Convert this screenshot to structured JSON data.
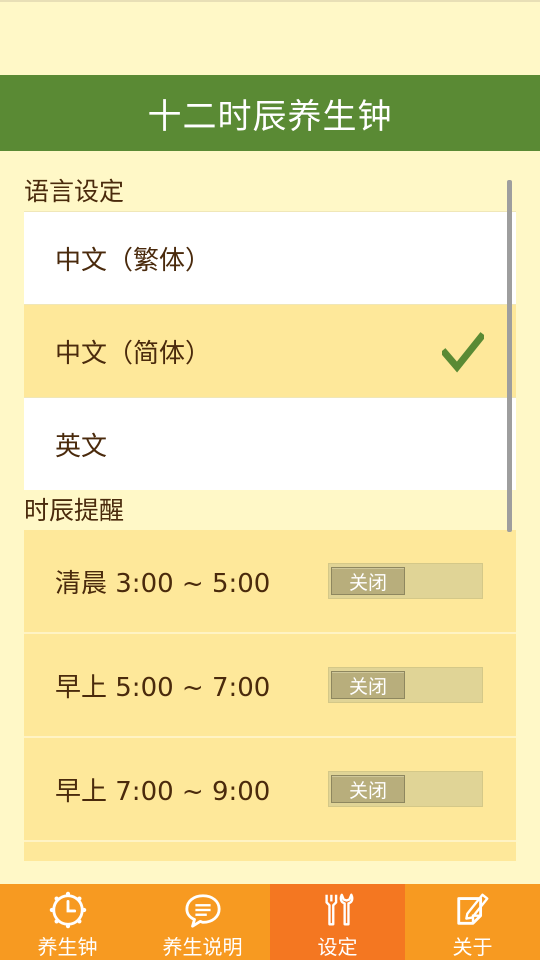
{
  "app": {
    "title": "十二时辰养生钟"
  },
  "language_section": {
    "header": "语言设定",
    "items": [
      {
        "label": "中文（繁体）",
        "selected": false
      },
      {
        "label": "中文（简体）",
        "selected": true
      },
      {
        "label": "英文",
        "selected": false
      }
    ]
  },
  "reminder_section": {
    "header": "时辰提醒",
    "items": [
      {
        "label": "清晨 3:00 ~ 5:00",
        "toggle": "关闭"
      },
      {
        "label": "早上 5:00 ~ 7:00",
        "toggle": "关闭"
      },
      {
        "label": "早上 7:00 ~ 9:00",
        "toggle": "关闭"
      }
    ]
  },
  "bottom_nav": [
    {
      "label": "养生钟",
      "icon": "clock-icon",
      "active": false
    },
    {
      "label": "养生说明",
      "icon": "chat-bubble-icon",
      "active": false
    },
    {
      "label": "设定",
      "icon": "tools-icon",
      "active": true
    },
    {
      "label": "关于",
      "icon": "note-edit-icon",
      "active": false
    }
  ],
  "colors": {
    "titlebar": "#5a8a34",
    "background": "#fff8c7",
    "nav": "#f79a21",
    "nav_active": "#f47721",
    "highlight": "#fee89a",
    "check": "#5a8a34"
  }
}
